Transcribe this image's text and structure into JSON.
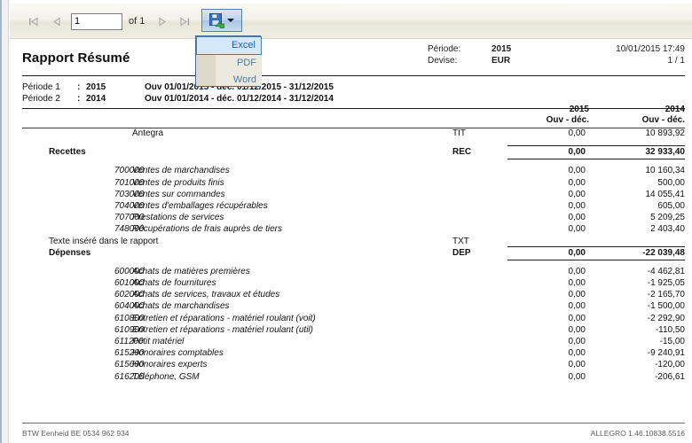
{
  "toolbar": {
    "page_value": "1",
    "of_label": "of 1",
    "first_icon": "first-page-icon",
    "prev_icon": "previous-page-icon",
    "next_icon": "next-page-icon",
    "last_icon": "last-page-icon",
    "export_icon": "save-export-icon",
    "caret_icon": "chevron-down-icon"
  },
  "export_menu": {
    "items": [
      {
        "label": "Excel",
        "selected": true
      },
      {
        "label": "PDF",
        "selected": false
      },
      {
        "label": "Word",
        "selected": false
      }
    ]
  },
  "report": {
    "title": "Rapport Résumé",
    "header": {
      "periode_label": "Période:",
      "periode_value": "2015",
      "devise_label": "Devise:",
      "devise_value": "EUR",
      "timestamp": "10/01/2015 17:49",
      "pagination": "1 / 1"
    },
    "periods": [
      {
        "name": "Période 1",
        "colon": ":",
        "year": "2015",
        "range": "Ouv 01/01/2015 - déc. 01/12/2015 - 31/12/2015"
      },
      {
        "name": "Période 2",
        "colon": ":",
        "year": "2014",
        "range": "Ouv 01/01/2014 - déc. 01/12/2014 - 31/12/2014"
      }
    ],
    "columns": {
      "col1_year": "2015",
      "col1_sub": "Ouv - déc.",
      "col2_year": "2014",
      "col2_sub": "Ouv - déc."
    },
    "rows": [
      {
        "kind": "title",
        "account": "",
        "label": "Antegra",
        "code": "TIT",
        "v1": "0,00",
        "v2": "10 893,92"
      },
      {
        "kind": "spacer"
      },
      {
        "kind": "section",
        "account": "",
        "label": "Recettes",
        "code": "REC",
        "v1": "0,00",
        "v2": "32 933,40"
      },
      {
        "kind": "spacer"
      },
      {
        "kind": "detail",
        "account": "700000",
        "label": "Ventes de marchandises",
        "code": "",
        "v1": "0,00",
        "v2": "10 160,34"
      },
      {
        "kind": "detail",
        "account": "701000",
        "label": "Ventes de produits finis",
        "code": "",
        "v1": "0,00",
        "v2": "500,00"
      },
      {
        "kind": "detail",
        "account": "703000",
        "label": "Ventes sur commandes",
        "code": "",
        "v1": "0,00",
        "v2": "14 055,41"
      },
      {
        "kind": "detail",
        "account": "704000",
        "label": "Ventes d'emballages récupérables",
        "code": "",
        "v1": "0,00",
        "v2": "605,00"
      },
      {
        "kind": "detail",
        "account": "707000",
        "label": "Prestations de services",
        "code": "",
        "v1": "0,00",
        "v2": "5 209,25"
      },
      {
        "kind": "detail",
        "account": "748000",
        "label": "Récupérations de frais auprès de tiers",
        "code": "",
        "v1": "0,00",
        "v2": "2 403,40"
      },
      {
        "kind": "txt",
        "account": "",
        "label": "Texte inséré dans le rapport",
        "code": "TXT",
        "v1": "",
        "v2": ""
      },
      {
        "kind": "section",
        "account": "",
        "label": "Dépenses",
        "code": "DEP",
        "v1": "0,00",
        "v2": "-22 039,48"
      },
      {
        "kind": "spacer"
      },
      {
        "kind": "detail",
        "account": "600000",
        "label": "Achats de matières premières",
        "code": "",
        "v1": "0,00",
        "v2": "-4 462,81"
      },
      {
        "kind": "detail",
        "account": "601000",
        "label": "Achats de fournitures",
        "code": "",
        "v1": "0,00",
        "v2": "-1 925,05"
      },
      {
        "kind": "detail",
        "account": "602000",
        "label": "Achats de services, travaux et études",
        "code": "",
        "v1": "0,00",
        "v2": "-2 165,70"
      },
      {
        "kind": "detail",
        "account": "604000",
        "label": "Achats de marchandises",
        "code": "",
        "v1": "0,00",
        "v2": "-1 500,00"
      },
      {
        "kind": "detail",
        "account": "610800",
        "label": "Entretien et réparations - matériel roulant (voit)",
        "code": "",
        "v1": "0,00",
        "v2": "-2 292,90"
      },
      {
        "kind": "detail",
        "account": "610900",
        "label": "Entretien et réparations - matériel roulant (util)",
        "code": "",
        "v1": "0,00",
        "v2": "-110,50"
      },
      {
        "kind": "detail",
        "account": "611200",
        "label": "Petit matériel",
        "code": "",
        "v1": "0,00",
        "v2": "-15,00"
      },
      {
        "kind": "detail",
        "account": "615200",
        "label": "Honoraires comptables",
        "code": "",
        "v1": "0,00",
        "v2": "-9 240,91"
      },
      {
        "kind": "detail",
        "account": "615600",
        "label": "Honoraires experts",
        "code": "",
        "v1": "0,00",
        "v2": "-120,00"
      },
      {
        "kind": "detail",
        "account": "616200",
        "label": "Téléphone, GSM",
        "code": "",
        "v1": "0,00",
        "v2": "-206,61"
      }
    ],
    "footer": {
      "left": "BTW Eenheid BE 0534 962 934",
      "right": "ALLEGRO 1.46.10838.5516"
    }
  },
  "colors": {
    "title_band": "#d2d2d2",
    "menu_accent": "#4f7aab",
    "menu_selected_bg": "#d5e8f7",
    "toolbar_border": "#9fb6cd"
  }
}
